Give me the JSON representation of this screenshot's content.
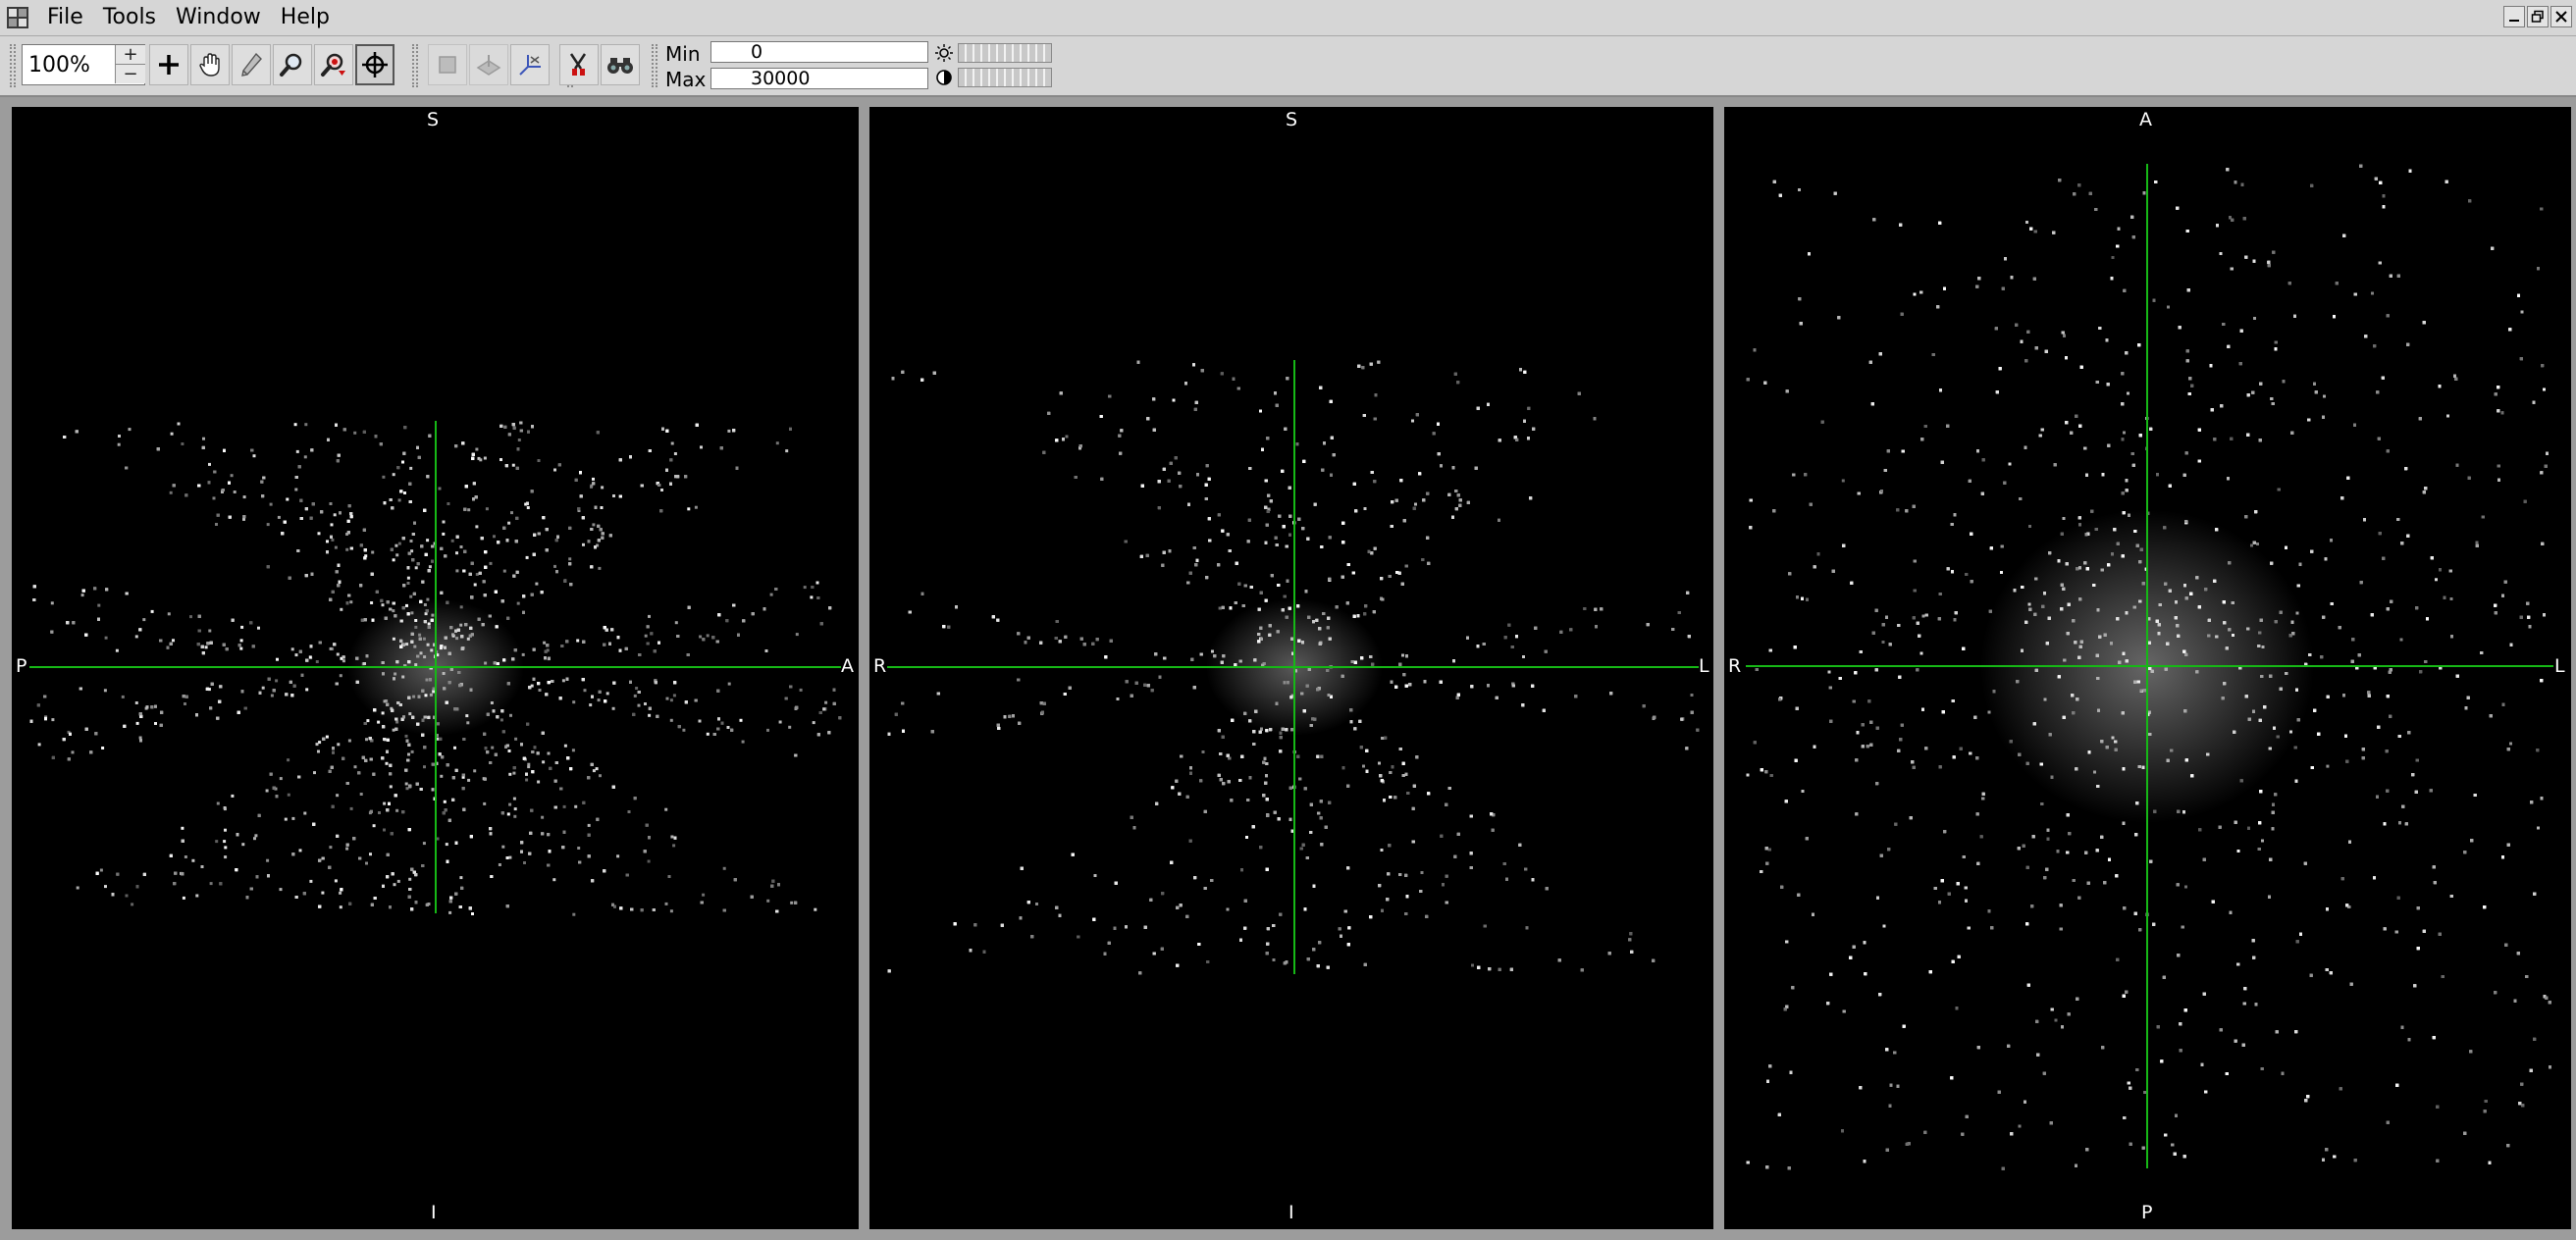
{
  "menubar": {
    "items": [
      "File",
      "Tools",
      "Window",
      "Help"
    ],
    "app_icon": "app-grid-icon",
    "window_controls": [
      "minimize-icon",
      "restore-icon",
      "close-icon"
    ]
  },
  "toolbar": {
    "zoom_value": "100%",
    "tools": [
      {
        "name": "crosshair-tool",
        "icon": "plus-icon",
        "active": false
      },
      {
        "name": "pan-tool",
        "icon": "hand-icon",
        "active": false
      },
      {
        "name": "pencil-tool",
        "icon": "pencil-icon",
        "active": false
      },
      {
        "name": "zoom-tool",
        "icon": "magnifier-icon",
        "active": false
      },
      {
        "name": "zoom-region-tool",
        "icon": "magnifier-region-icon",
        "active": false
      },
      {
        "name": "locate-tool",
        "icon": "target-icon",
        "active": true
      },
      {
        "name": "box-tool",
        "icon": "box-icon",
        "active": false,
        "disabled": true
      },
      {
        "name": "plane-tool",
        "icon": "plane-icon",
        "active": false,
        "disabled": true
      },
      {
        "name": "axes-tool",
        "icon": "axes-icon",
        "active": false
      },
      {
        "name": "filter-tool",
        "icon": "filter-icon",
        "active": false
      },
      {
        "name": "view-tool",
        "icon": "binoculars-icon",
        "active": false
      }
    ],
    "min_label": "Min",
    "min_value": "0",
    "max_label": "Max",
    "max_value": "30000",
    "brightness_icon": "sun-icon",
    "contrast_icon": "contrast-icon"
  },
  "panels": [
    {
      "name": "sagittal",
      "top": "S",
      "bottom": "I",
      "left": "P",
      "right": "A"
    },
    {
      "name": "coronal",
      "top": "S",
      "bottom": "I",
      "left": "R",
      "right": "L"
    },
    {
      "name": "axial",
      "top": "A",
      "bottom": "P",
      "left": "R",
      "right": "L"
    }
  ],
  "colors": {
    "crosshair": "#16b816",
    "panel_bg": "#000000",
    "signal": "#ffffff"
  }
}
